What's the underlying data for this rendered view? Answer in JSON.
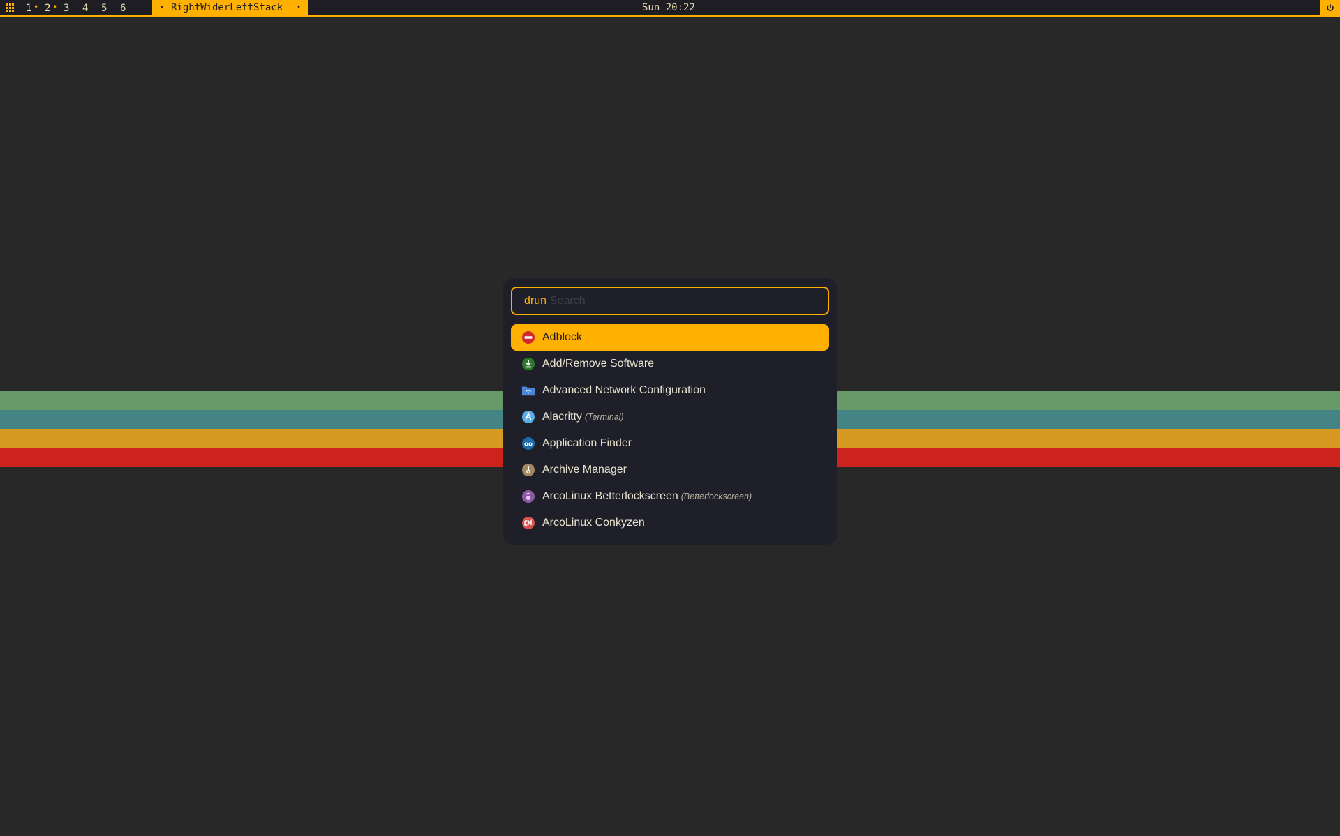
{
  "topbar": {
    "workspaces": [
      {
        "label": "1",
        "active_dot": "•"
      },
      {
        "label": "2",
        "active_dot": "•"
      },
      {
        "label": "3",
        "active_dot": ""
      },
      {
        "label": "4",
        "active_dot": ""
      },
      {
        "label": "5",
        "active_dot": ""
      },
      {
        "label": "6",
        "active_dot": ""
      }
    ],
    "layout_bullet": "•",
    "layout_name": "RightWiderLeftStack",
    "clock": "Sun 20:22",
    "accent_color": "#ffb000"
  },
  "launcher": {
    "mode": "drun",
    "search_value": "",
    "search_placeholder": "Search",
    "items": [
      {
        "label": "Adblock",
        "generic": "",
        "icon": "adblock-icon",
        "selected": true
      },
      {
        "label": "Add/Remove Software",
        "generic": "",
        "icon": "download-icon",
        "selected": false
      },
      {
        "label": "Advanced Network Configuration",
        "generic": "",
        "icon": "network-folder-icon",
        "selected": false
      },
      {
        "label": "Alacritty",
        "generic": "(Terminal)",
        "icon": "alacritty-icon",
        "selected": false
      },
      {
        "label": "Application Finder",
        "generic": "",
        "icon": "binoculars-icon",
        "selected": false
      },
      {
        "label": "Archive Manager",
        "generic": "",
        "icon": "archive-icon",
        "selected": false
      },
      {
        "label": "ArcoLinux Betterlockscreen",
        "generic": "(Betterlockscreen)",
        "icon": "lockscreen-icon",
        "selected": false
      },
      {
        "label": "ArcoLinux Conkyzen",
        "generic": "",
        "icon": "conkyzen-icon",
        "selected": false
      }
    ]
  },
  "wallpaper": {
    "stripe_colors": [
      "#689a69",
      "#458485",
      "#d79921",
      "#cc241d"
    ]
  }
}
